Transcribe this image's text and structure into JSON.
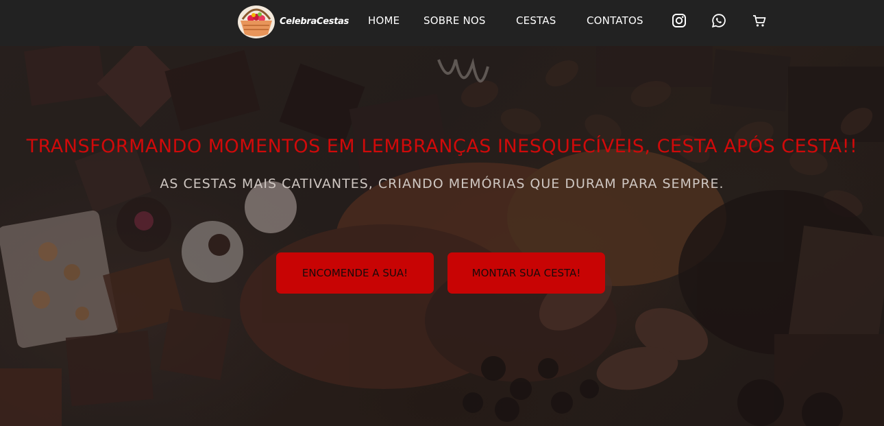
{
  "navbar": {
    "brand": "CelebraCestas",
    "links": [
      "HOME",
      "SOBRE NOS",
      "CESTAS",
      "CONTATOS"
    ],
    "icons": [
      "instagram-icon",
      "whatsapp-icon",
      "cart-icon"
    ]
  },
  "hero": {
    "title": "TRANSFORMANDO MOMENTOS EM LEMBRANÇAS INESQUECÍVEIS, CESTA APÓS CESTA!!",
    "subtitle": "AS CESTAS MAIS CATIVANTES, CRIANDO MEMÓRIAS QUE DURAM PARA SEMPRE.",
    "buttons": [
      "ENCOMENDE A SUA!",
      "MONTAR SUA CESTA!"
    ]
  },
  "colors": {
    "navbar_bg": "#222222",
    "accent_red": "#c80404",
    "title_red": "#d00a0a",
    "subtitle_text": "#cfc7c2"
  }
}
